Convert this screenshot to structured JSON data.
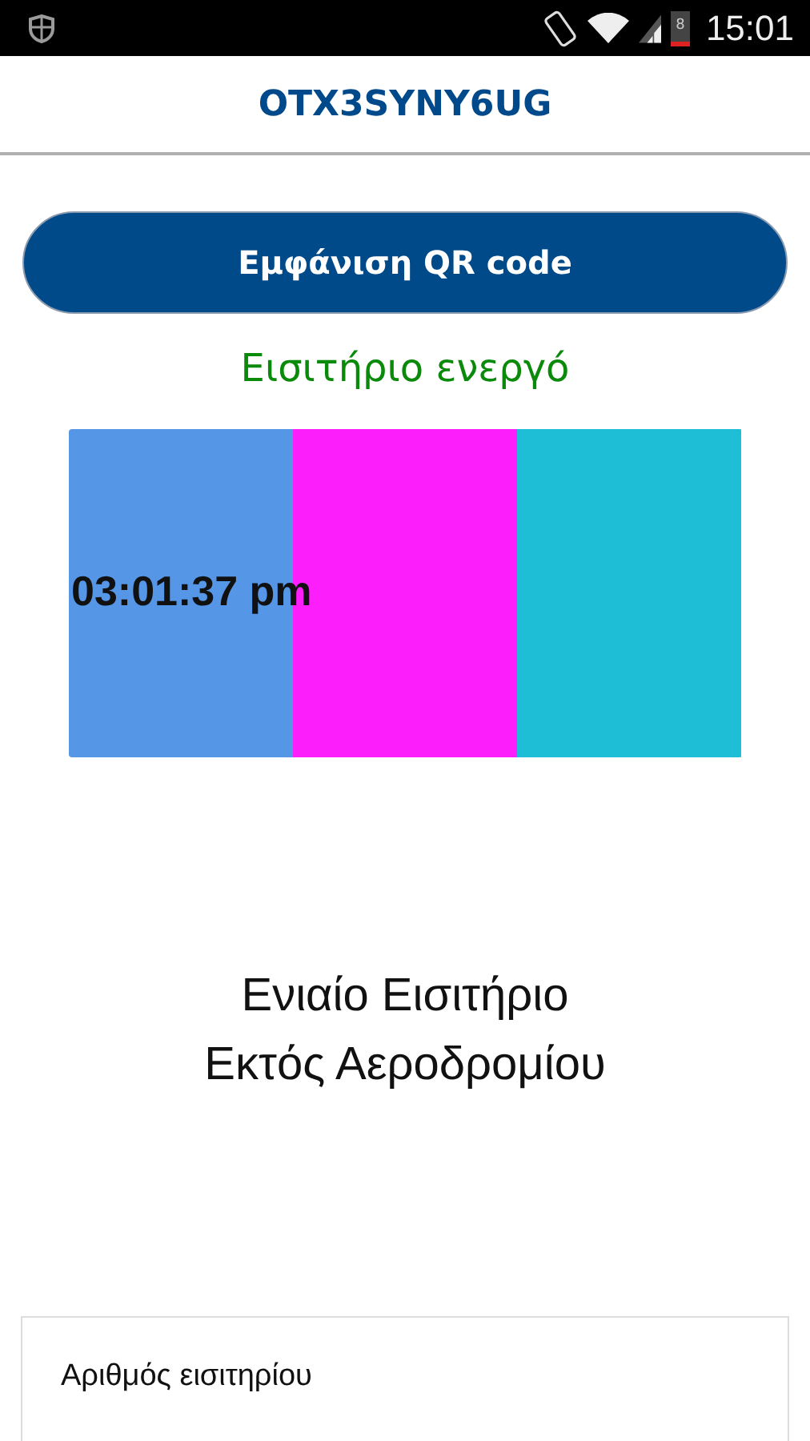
{
  "status_bar": {
    "time": "15:01",
    "battery_text": "8"
  },
  "header": {
    "title": "OTX3SYNY6UG"
  },
  "qr_button": {
    "label": "Εμφάνιση QR code"
  },
  "ticket_status": {
    "text": "Εισιτήριο ενεργό"
  },
  "validity_panel": {
    "time": "03:01:37 pm",
    "stripes": [
      {
        "color": "#5596e6"
      },
      {
        "color": "#fc1ffc"
      },
      {
        "color": "#1ebfd6"
      }
    ]
  },
  "ticket_type": {
    "lines": [
      "Ενιαίο Εισιτήριο",
      "Εκτός Αεροδρομίου"
    ]
  },
  "details_card": {
    "label": "Αριθμός εισιτηρίου"
  }
}
